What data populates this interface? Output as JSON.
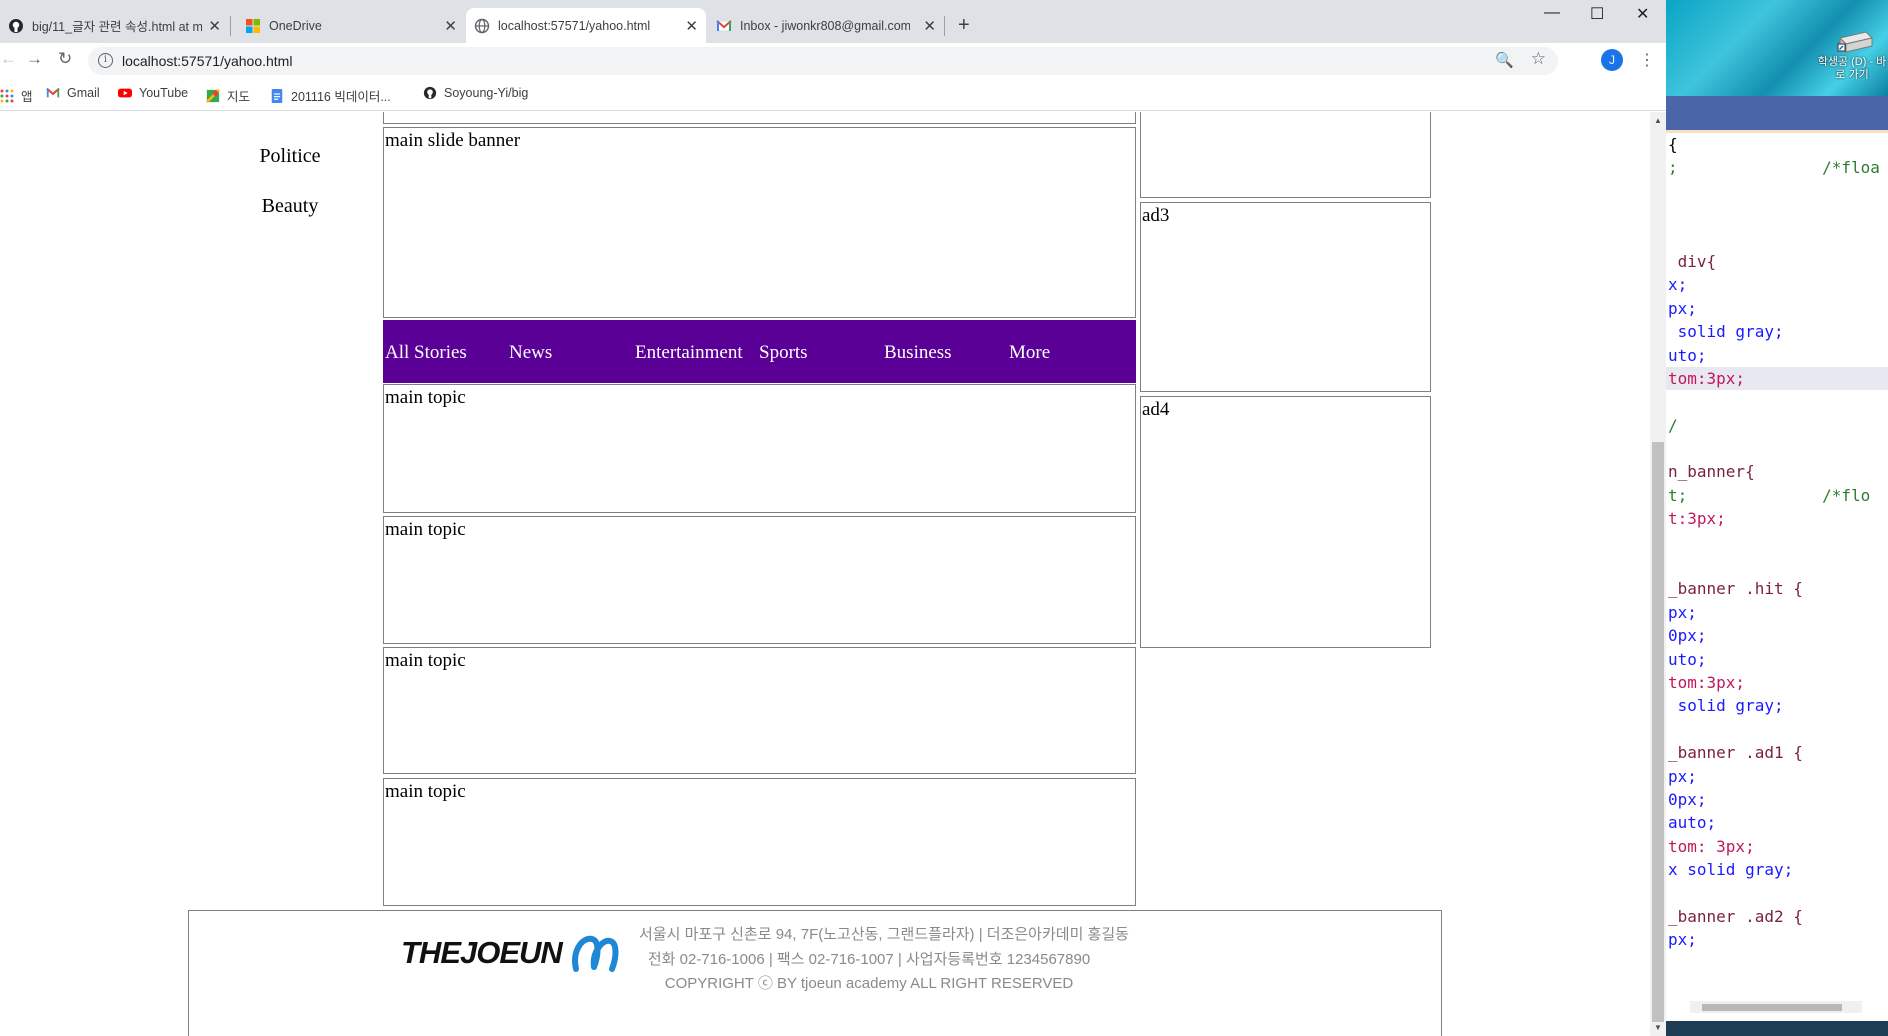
{
  "browser": {
    "tabs": [
      {
        "title": "big/11_글자 관련 속성.html at m",
        "icon": "github-icon",
        "active": false
      },
      {
        "title": "OneDrive",
        "icon": "microsoft-icon",
        "active": false
      },
      {
        "title": "localhost:57571/yahoo.html",
        "icon": "globe-icon",
        "active": true
      },
      {
        "title": "Inbox - jiwonkr808@gmail.com",
        "icon": "gmail-icon",
        "active": false
      }
    ],
    "new_tab": "+",
    "window_controls": {
      "minimize": "—",
      "maximize": "☐",
      "close": "✕"
    },
    "url": "localhost:57571/yahoo.html",
    "profile_initial": "J",
    "bookmarks": [
      {
        "label": "앱",
        "icon": "apps-grid-icon"
      },
      {
        "label": "Gmail",
        "icon": "gmail-icon"
      },
      {
        "label": "YouTube",
        "icon": "youtube-icon"
      },
      {
        "label": "지도",
        "icon": "maps-icon"
      },
      {
        "label": "201116 빅데이터...",
        "icon": "docs-icon"
      },
      {
        "label": "Soyoung-Yi/big",
        "icon": "github-icon"
      }
    ]
  },
  "page": {
    "side_nav": [
      "Politice",
      "Beauty"
    ],
    "slide_banner": "main slide banner",
    "nav_items": [
      "All Stories",
      "News",
      "Entertainment",
      "Sports",
      "Business",
      "More"
    ],
    "nav_color": "#5a0097",
    "topics": [
      "main topic",
      "main topic",
      "main topic",
      "main topic"
    ],
    "ads": [
      "ad3",
      "ad4"
    ],
    "footer": {
      "logo_text": "THEJOEUN",
      "address": "서울시 마포구 신촌로 94, 7F(노고산동, 그랜드플라자) | 더조은아카데미 홍길동",
      "contact": "전화 02-716-1006 | 팩스 02-716-1007 | 사업자등록번호 1234567890",
      "copyright": "COPYRIGHT ⓒ BY tjoeun academy ALL RIGHT RESERVED"
    }
  },
  "desktop": {
    "drive_label": "학생공 (D) - 바로 가기"
  },
  "editor": {
    "lines": [
      {
        "text": "{",
        "color": "#000000"
      },
      {
        "text": ";               /*floa",
        "color": "#2e7d32"
      },
      {
        "text": "",
        "color": "#000000"
      },
      {
        "text": "",
        "color": "#000000"
      },
      {
        "text": "",
        "color": "#000000"
      },
      {
        "text": " div{",
        "color": "#7a1f3d"
      },
      {
        "text": "x;",
        "color": "#1a1aff"
      },
      {
        "text": "px;",
        "color": "#1a1aff"
      },
      {
        "text": " solid gray;",
        "color": "#1a1aff"
      },
      {
        "text": "uto;",
        "color": "#1a1aff"
      },
      {
        "text": "tom:3px;",
        "color": "#c2185b"
      },
      {
        "text": "",
        "color": "#000000"
      },
      {
        "text": "/",
        "color": "#2e7d32"
      },
      {
        "text": "",
        "color": "#000000"
      },
      {
        "text": "n_banner{",
        "color": "#7a1f3d"
      },
      {
        "text": "t;              /*flo",
        "color": "#2e7d32"
      },
      {
        "text": "t:3px;",
        "color": "#c2185b"
      },
      {
        "text": "",
        "color": "#000000"
      },
      {
        "text": "",
        "color": "#000000"
      },
      {
        "text": "_banner .hit {",
        "color": "#7a1f3d"
      },
      {
        "text": "px;",
        "color": "#1a1aff"
      },
      {
        "text": "0px;",
        "color": "#1a1aff"
      },
      {
        "text": "uto;",
        "color": "#1a1aff"
      },
      {
        "text": "tom:3px;",
        "color": "#c2185b"
      },
      {
        "text": " solid gray;",
        "color": "#1a1aff"
      },
      {
        "text": "",
        "color": "#000000"
      },
      {
        "text": "_banner .ad1 {",
        "color": "#7a1f3d"
      },
      {
        "text": "px;",
        "color": "#1a1aff"
      },
      {
        "text": "0px;",
        "color": "#1a1aff"
      },
      {
        "text": "auto;",
        "color": "#1a1aff"
      },
      {
        "text": "tom: 3px;",
        "color": "#c2185b"
      },
      {
        "text": "x solid gray;",
        "color": "#1a1aff"
      },
      {
        "text": "",
        "color": "#000000"
      },
      {
        "text": "_banner .ad2 {",
        "color": "#7a1f3d"
      },
      {
        "text": "px;",
        "color": "#1a1aff"
      }
    ]
  }
}
